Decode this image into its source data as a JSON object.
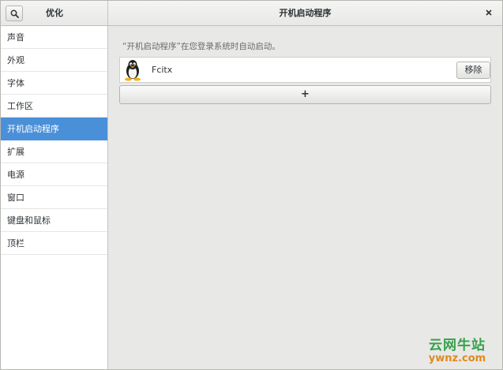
{
  "header": {
    "app_title": "优化",
    "page_title": "开机启动程序",
    "icons": {
      "search": "search-icon",
      "close": "close-icon"
    }
  },
  "sidebar": {
    "items": [
      {
        "label": "声音"
      },
      {
        "label": "外观"
      },
      {
        "label": "字体"
      },
      {
        "label": "工作区"
      },
      {
        "label": "开机启动程序",
        "selected": true
      },
      {
        "label": "扩展"
      },
      {
        "label": "电源"
      },
      {
        "label": "窗口"
      },
      {
        "label": "键盘和鼠标"
      },
      {
        "label": "顶栏"
      }
    ]
  },
  "main": {
    "hint": "“开机启动程序”在您登录系统时自动启动。",
    "startup_apps": [
      {
        "name": "Fcitx",
        "icon": "tux-penguin-icon",
        "remove_label": "移除"
      }
    ],
    "add_label": "+"
  },
  "watermark": {
    "cn": "云网牛站",
    "en": "ywnz.com"
  },
  "colors": {
    "accent": "#4a90d9",
    "watermark_green": "#37a14a",
    "watermark_orange": "#e08a1a"
  }
}
